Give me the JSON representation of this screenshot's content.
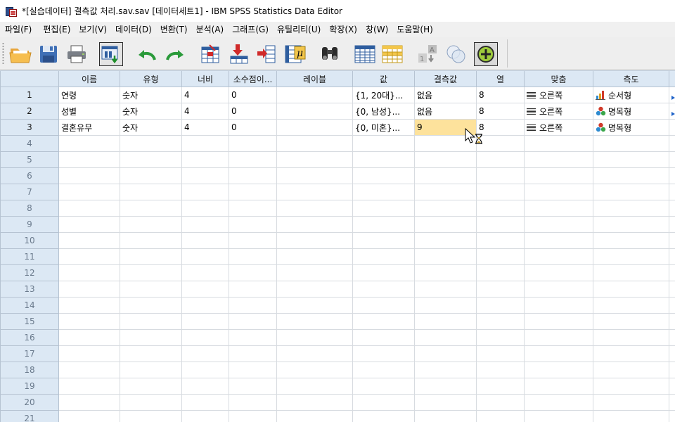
{
  "window": {
    "title": "*[실습데이터] 결측값 처리.sav.sav [데이터세트1] - IBM SPSS Statistics Data Editor"
  },
  "menu": [
    "파일(F)",
    "편집(E)",
    "보기(V)",
    "데이터(D)",
    "변환(T)",
    "분석(A)",
    "그래프(G)",
    "유틸리티(U)",
    "확장(X)",
    "창(W)",
    "도움말(H)"
  ],
  "toolbar": {
    "buttons": [
      "open-folder-icon",
      "save-icon",
      "print-icon",
      "dialog-recall-icon",
      "undo-icon",
      "redo-icon",
      "goto-case-icon",
      "insert-case-icon",
      "insert-variable-icon",
      "variables-icon",
      "find-icon",
      "split-file-icon",
      "select-cases-icon",
      "weight-cases-icon",
      "value-labels-icon",
      "use-sets-icon",
      "spell-check-icon"
    ]
  },
  "grid": {
    "columns": [
      "이름",
      "유형",
      "너비",
      "소수점이...",
      "레이블",
      "값",
      "결측값",
      "열",
      "맞춤",
      "측도"
    ],
    "rows": [
      {
        "n": "1",
        "name": "연령",
        "type": "숫자",
        "width": "4",
        "decimals": "0",
        "label": "",
        "values": "{1, 20대}...",
        "missing": "없음",
        "columns": "8",
        "align": "오른쪽",
        "measure": "순서형",
        "measure_icon": "ordinal-icon"
      },
      {
        "n": "2",
        "name": "성별",
        "type": "숫자",
        "width": "4",
        "decimals": "0",
        "label": "",
        "values": "{0, 남성}...",
        "missing": "없음",
        "columns": "8",
        "align": "오른쪽",
        "measure": "명목형",
        "measure_icon": "nominal-icon"
      },
      {
        "n": "3",
        "name": "결혼유무",
        "type": "숫자",
        "width": "4",
        "decimals": "0",
        "label": "",
        "values": "{0, 미혼}...",
        "missing": "9",
        "columns": "8",
        "align": "오른쪽",
        "measure": "명목형",
        "measure_icon": "nominal-icon"
      }
    ],
    "empty_row_numbers": [
      "4",
      "5",
      "6",
      "7",
      "8",
      "9",
      "10",
      "11",
      "12",
      "13",
      "14",
      "15",
      "16",
      "17",
      "18",
      "19",
      "20",
      "21"
    ]
  },
  "colors": {
    "header_bg": "#dce8f4",
    "selected_cell": "#fde29c",
    "grid_line": "#d7dbe0"
  }
}
